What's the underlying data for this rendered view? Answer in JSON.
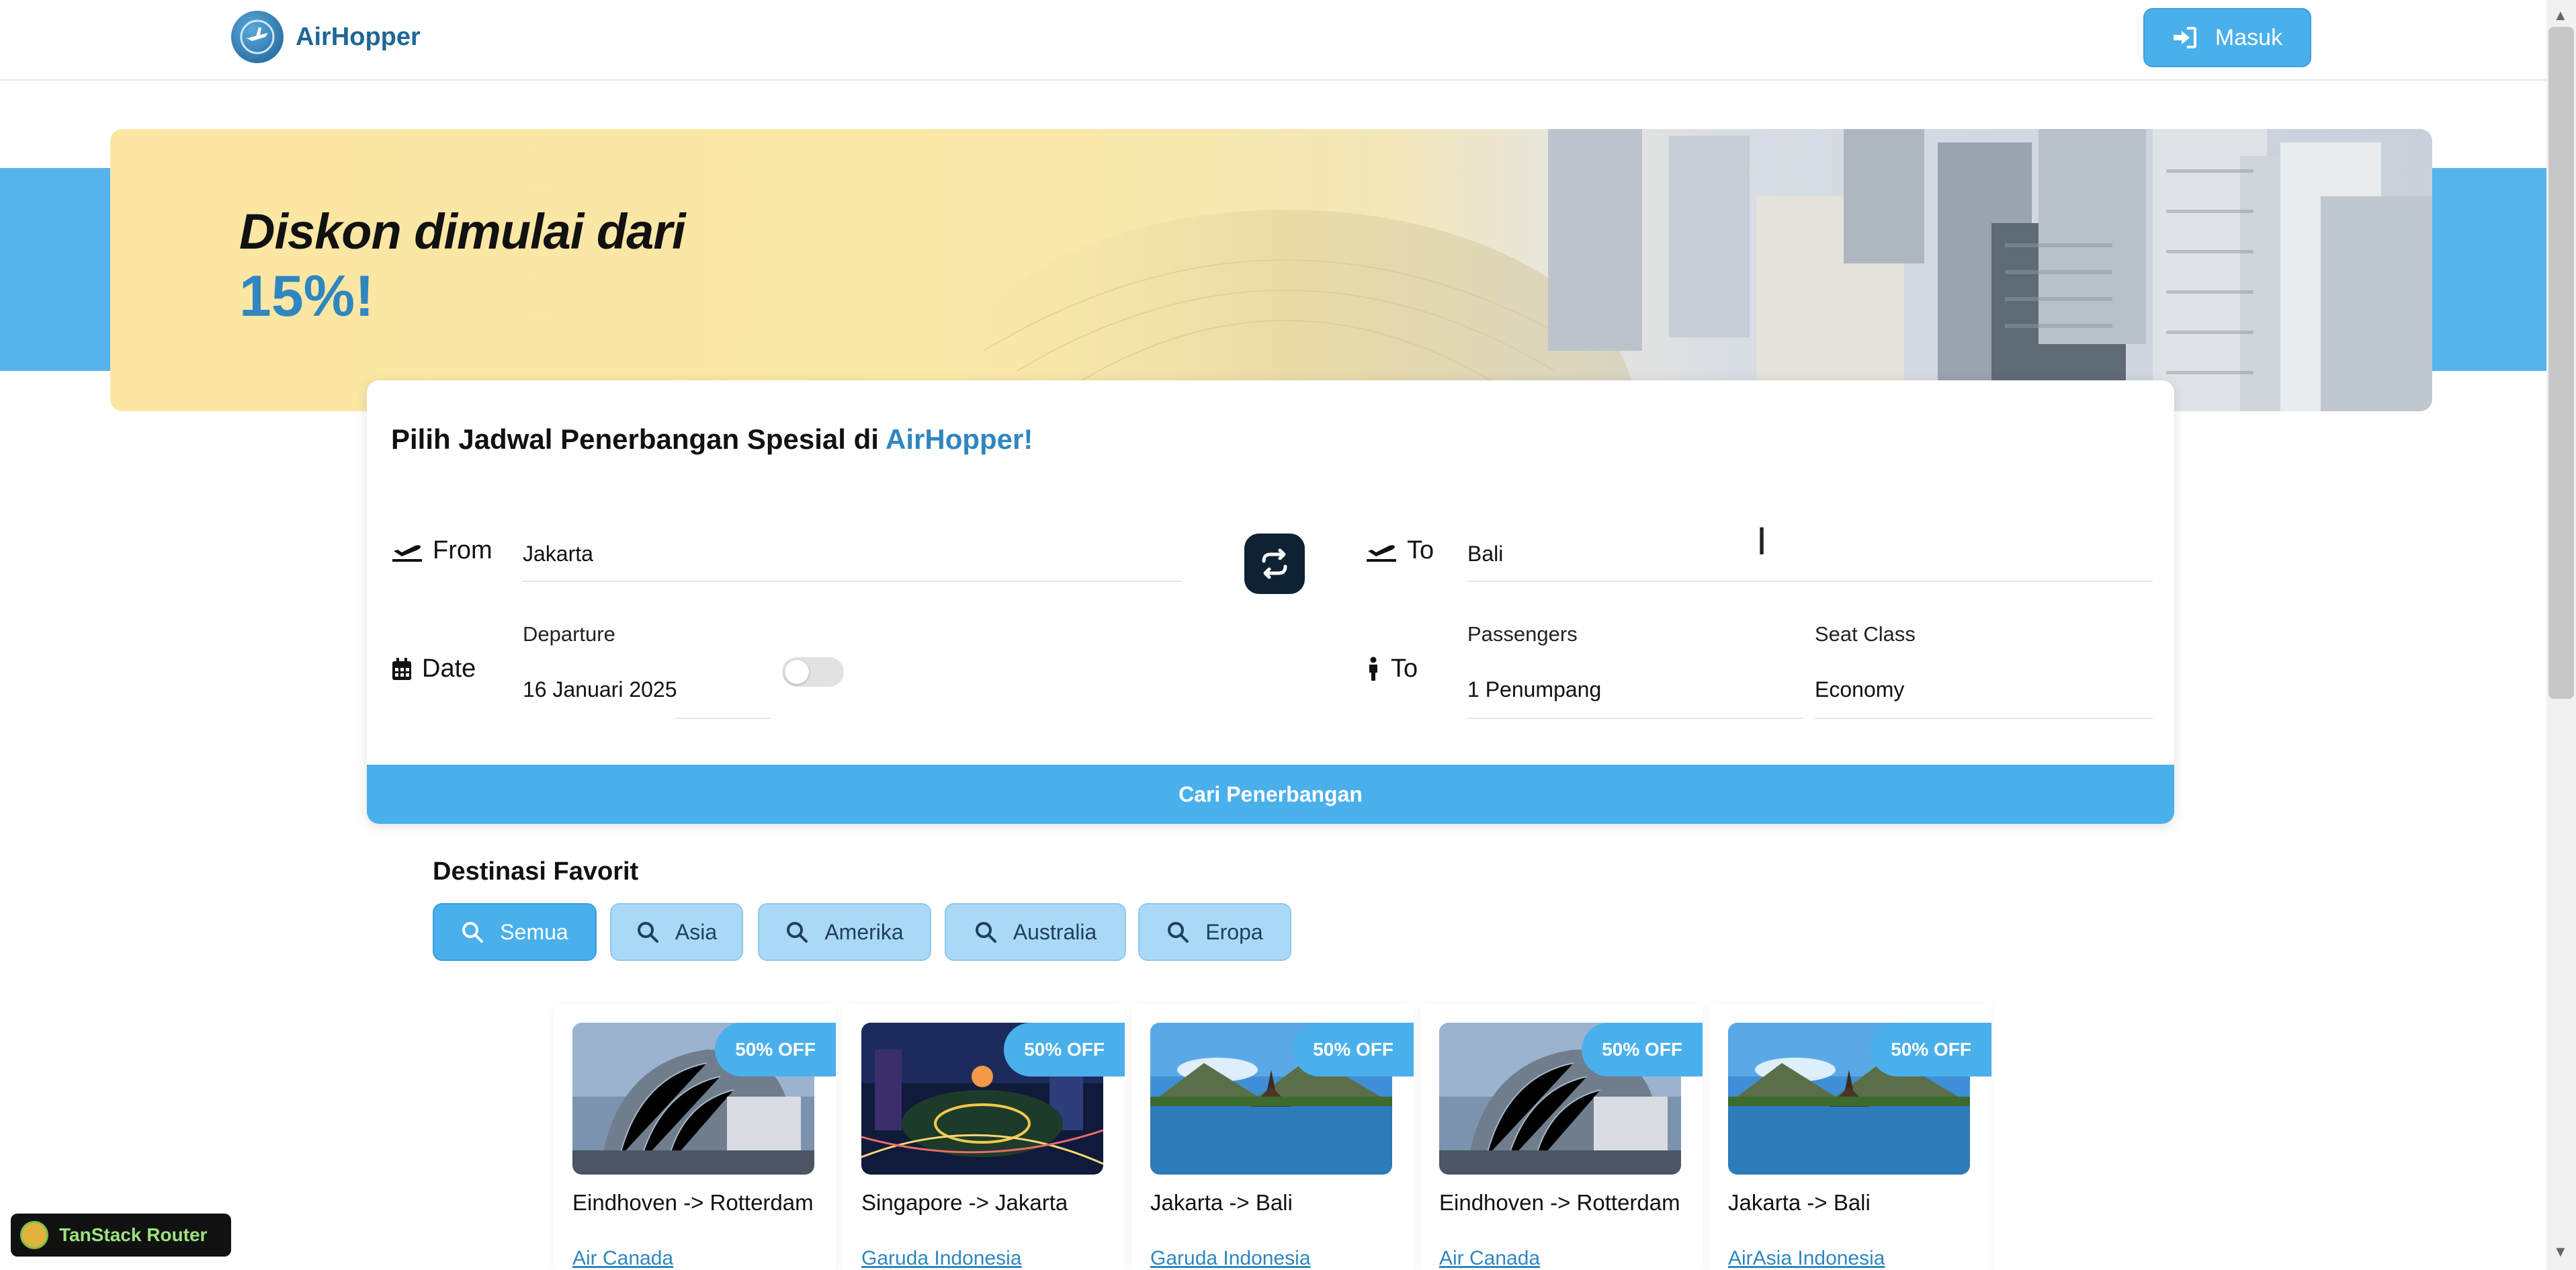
{
  "nav": {
    "brand": "AirHopper",
    "login_label": "Masuk"
  },
  "banner": {
    "title": "Diskon dimulai dari",
    "highlight": "15%!"
  },
  "search": {
    "title_prefix": "Pilih Jadwal Penerbangan Spesial di ",
    "title_brand": "AirHopper!",
    "from_label": "From",
    "from_value": "Jakarta",
    "to_label": "To",
    "to_value": "Bali",
    "date_label": "Date",
    "departure_label": "Departure",
    "departure_value": "16 Januari 2025",
    "passenger_row_label": "To",
    "passengers_label": "Passengers",
    "passengers_value": "1 Penumpang",
    "seat_label": "Seat Class",
    "seat_value": "Economy",
    "submit_label": "Cari Penerbangan"
  },
  "favorites": {
    "title": "Destinasi Favorit",
    "chips": [
      {
        "label": "Semua",
        "active": true
      },
      {
        "label": "Asia",
        "active": false
      },
      {
        "label": "Amerika",
        "active": false
      },
      {
        "label": "Australia",
        "active": false
      },
      {
        "label": "Eropa",
        "active": false
      }
    ],
    "cards": [
      {
        "badge": "50% OFF",
        "route": "Eindhoven -> Rotterdam",
        "airline": "Air Canada",
        "image": "modern-building"
      },
      {
        "badge": "50% OFF",
        "route": "Singapore -> Jakarta",
        "airline": "Garuda Indonesia",
        "image": "city-night"
      },
      {
        "badge": "50% OFF",
        "route": "Jakarta -> Bali",
        "airline": "Garuda Indonesia",
        "image": "temple-lake"
      },
      {
        "badge": "50% OFF",
        "route": "Eindhoven -> Rotterdam",
        "airline": "Air Canada",
        "image": "modern-building"
      },
      {
        "badge": "50% OFF",
        "route": "Jakarta -> Bali",
        "airline": "AirAsia Indonesia",
        "image": "temple-lake"
      }
    ]
  },
  "devtools": {
    "label": "TanStack Router"
  },
  "colors": {
    "accent": "#4ab0ec",
    "brand": "#2f86c0",
    "chip": "#a9d9f6",
    "banner": "#fbe6a3"
  }
}
